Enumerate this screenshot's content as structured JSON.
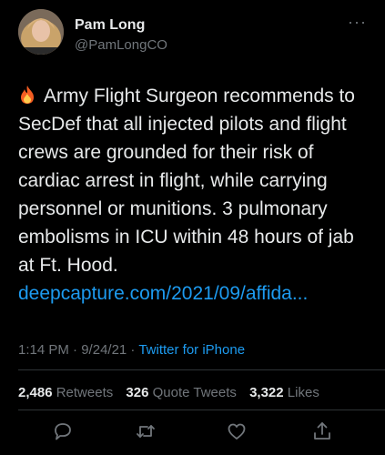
{
  "author": {
    "name": "Pam Long",
    "handle": "@PamLongCO",
    "more_icon": "more-horizontal-icon"
  },
  "tweet": {
    "emoji": "fire-emoji",
    "text": "Army Flight Surgeon recommends to SecDef that all injected pilots and flight crews are grounded for their risk of cardiac arrest in flight, while carrying personnel or munitions. 3 pulmonary embolisms in ICU within 48 hours of jab at Ft. Hood.",
    "link": "deepcapture.com/2021/09/affida..."
  },
  "meta": {
    "time": "1:14 PM",
    "separator1": " · ",
    "date": "9/24/21",
    "separator2": " · ",
    "source": "Twitter for iPhone"
  },
  "stats": {
    "retweets_count": "2,486",
    "retweets_label": "Retweets",
    "quotes_count": "326",
    "quotes_label": "Quote Tweets",
    "likes_count": "3,322",
    "likes_label": "Likes"
  },
  "actions": [
    "reply-icon",
    "retweet-icon",
    "like-icon",
    "share-icon"
  ],
  "colors": {
    "background": "#000000",
    "text": "#e7e9ea",
    "secondary": "#71767b",
    "accent": "#1d9bf0",
    "divider": "#2f3336"
  }
}
